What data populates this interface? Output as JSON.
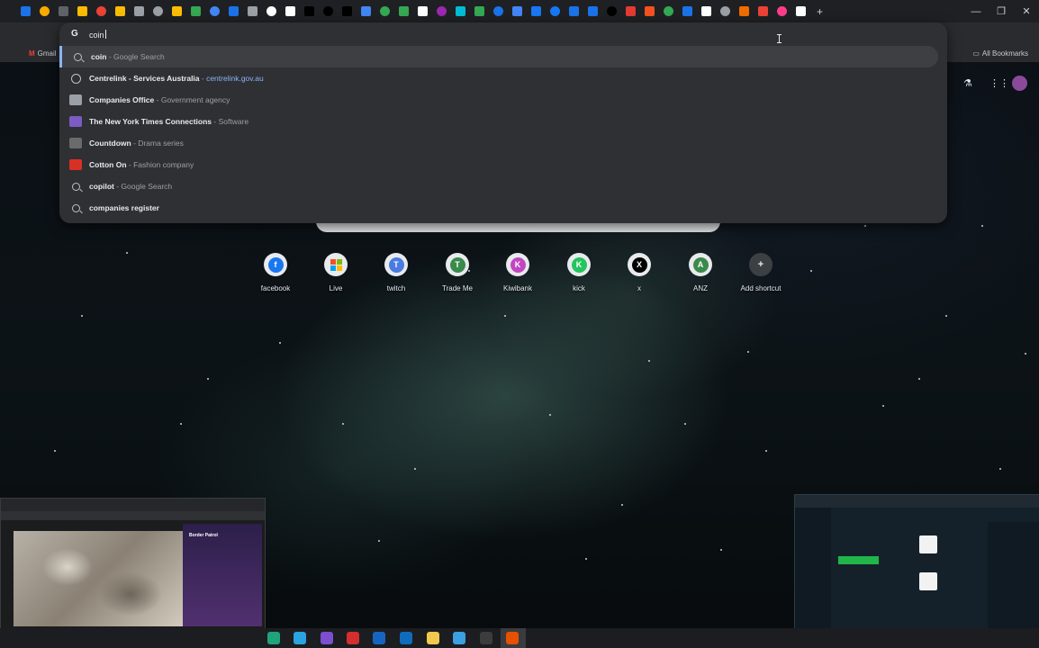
{
  "omnibox": {
    "query": "coin",
    "suggestions": [
      {
        "type": "search",
        "main": "coin",
        "sep": " - ",
        "desc": "Google Search",
        "url": "",
        "icon": "search-icon"
      },
      {
        "type": "url",
        "main": "Centrelink - Services Australia",
        "sep": " - ",
        "desc": "",
        "url": "centrelink.gov.au",
        "icon": "globe-icon"
      },
      {
        "type": "entity",
        "main": "Companies Office",
        "sep": " - ",
        "desc": "Government agency",
        "url": "",
        "icon": "companies-office-icon",
        "color": "#9aa0a6"
      },
      {
        "type": "entity",
        "main": "The New York Times Connections",
        "sep": " - ",
        "desc": "Software",
        "url": "",
        "icon": "connections-icon",
        "color": "#7b5cc2"
      },
      {
        "type": "entity",
        "main": "Countdown",
        "sep": " - ",
        "desc": "Drama series",
        "url": "",
        "icon": "countdown-icon",
        "color": "#6b6b6b"
      },
      {
        "type": "entity",
        "main": "Cotton On",
        "sep": " - ",
        "desc": "Fashion company",
        "url": "",
        "icon": "cotton-on-icon",
        "color": "#d93025"
      },
      {
        "type": "search",
        "main": "copilot",
        "sep": " - ",
        "desc": "Google Search",
        "url": "",
        "icon": "search-icon"
      },
      {
        "type": "search",
        "main": "companies register",
        "sep": "",
        "desc": "",
        "url": "",
        "icon": "search-icon"
      }
    ]
  },
  "bookmarks": {
    "gmail": "Gmail",
    "all": "All Bookmarks"
  },
  "shortcuts": [
    {
      "label": "facebook",
      "letter": "f",
      "color": "#1877f2"
    },
    {
      "label": "Live",
      "letter": "",
      "color": "#ffffff"
    },
    {
      "label": "twitch",
      "letter": "T",
      "color": "#4a7be0"
    },
    {
      "label": "Trade Me",
      "letter": "T",
      "color": "#3a8a4c"
    },
    {
      "label": "Kiwibank",
      "letter": "K",
      "color": "#c246c2"
    },
    {
      "label": "kick",
      "letter": "K",
      "color": "#22c55e"
    },
    {
      "label": "x",
      "letter": "X",
      "color": "#000000"
    },
    {
      "label": "ANZ",
      "letter": "A",
      "color": "#3a8a4c"
    },
    {
      "label": "Add shortcut",
      "letter": "+",
      "color": "#e8eaed"
    }
  ],
  "thumbnail_left": {
    "title": "Border Patrol"
  },
  "colors": {
    "accent": "#8ab4f8",
    "omnibox_bg": "#2f3033"
  }
}
